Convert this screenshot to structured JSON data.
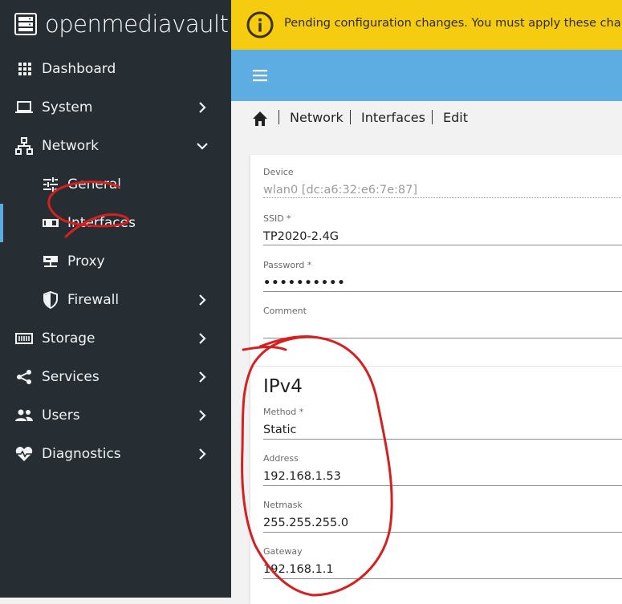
{
  "brand": {
    "name": "openmediavault"
  },
  "notification": {
    "text": "Pending configuration changes. You must apply these changes",
    "color": "#f6cc11"
  },
  "sidebar": {
    "items": [
      {
        "label": "Dashboard",
        "icon": "dashboard-grid-icon"
      },
      {
        "label": "System",
        "icon": "laptop-icon",
        "expandable": true
      },
      {
        "label": "Network",
        "icon": "network-icon",
        "expanded": true
      },
      {
        "label": "General",
        "icon": "sliders-icon",
        "sub": true
      },
      {
        "label": "Interfaces",
        "icon": "ethernet-card-icon",
        "sub": true,
        "active": true
      },
      {
        "label": "Proxy",
        "icon": "server-icon",
        "sub": true
      },
      {
        "label": "Firewall",
        "icon": "shield-icon",
        "sub": true,
        "expandable": true
      },
      {
        "label": "Storage",
        "icon": "storage-icon",
        "expandable": true
      },
      {
        "label": "Services",
        "icon": "share-icon",
        "expandable": true
      },
      {
        "label": "Users",
        "icon": "users-icon",
        "expandable": true
      },
      {
        "label": "Diagnostics",
        "icon": "heartbeat-icon",
        "expandable": true
      }
    ]
  },
  "breadcrumb": {
    "items": [
      "Network",
      "Interfaces",
      "Edit"
    ]
  },
  "form": {
    "device": {
      "label": "Device",
      "value": "wlan0 [dc:a6:32:e6:7e:87]"
    },
    "ssid": {
      "label": "SSID *",
      "value": "TP2020-2.4G"
    },
    "password": {
      "label": "Password *",
      "value": "••••••••••"
    },
    "comment": {
      "label": "Comment",
      "value": ""
    },
    "ipv4": {
      "title": "IPv4",
      "method": {
        "label": "Method *",
        "value": "Static"
      },
      "address": {
        "label": "Address",
        "value": "192.168.1.53"
      },
      "netmask": {
        "label": "Netmask",
        "value": "255.255.255.0"
      },
      "gateway": {
        "label": "Gateway",
        "value": "192.168.1.1"
      }
    }
  },
  "colors": {
    "sidebar_bg": "#262d33",
    "appbar": "#5dade2",
    "annotation": "#d42020"
  }
}
